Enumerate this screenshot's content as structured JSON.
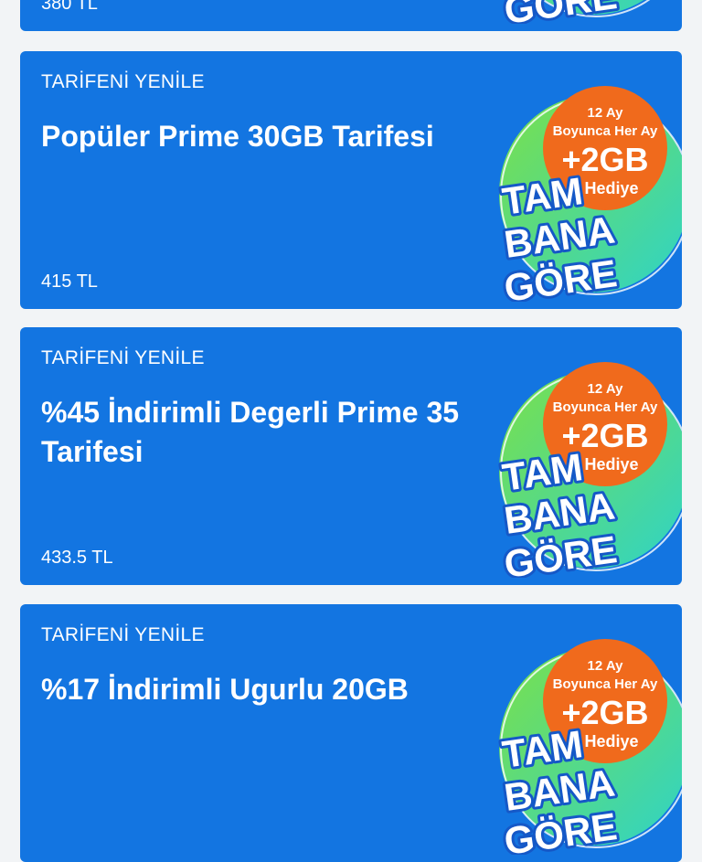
{
  "colors": {
    "page_bg": "#f2f4f6",
    "card_bg": "#1375e1",
    "badge_orange": "#f06a1c",
    "badge_green": "#7be04a",
    "badge_cyan": "#2ed3c8"
  },
  "badge": {
    "months": "12 Ay",
    "every_month": "Boyunca Her Ay",
    "gb": "+2GB",
    "gift": "Hediye",
    "word1": "TAM",
    "word2": "BANA",
    "word3": "GÖRE"
  },
  "cards": [
    {
      "kicker": "",
      "title": "",
      "price": "380 TL"
    },
    {
      "kicker": "TARİFENİ YENİLE",
      "title": "Popüler Prime 30GB Tarifesi",
      "price": "415 TL"
    },
    {
      "kicker": "TARİFENİ YENİLE",
      "title": "%45 İndirimli Degerli Prime 35 Tarifesi",
      "price": "433.5 TL"
    },
    {
      "kicker": "TARİFENİ YENİLE",
      "title": "%17 İndirimli Ugurlu 20GB",
      "price": ""
    }
  ]
}
